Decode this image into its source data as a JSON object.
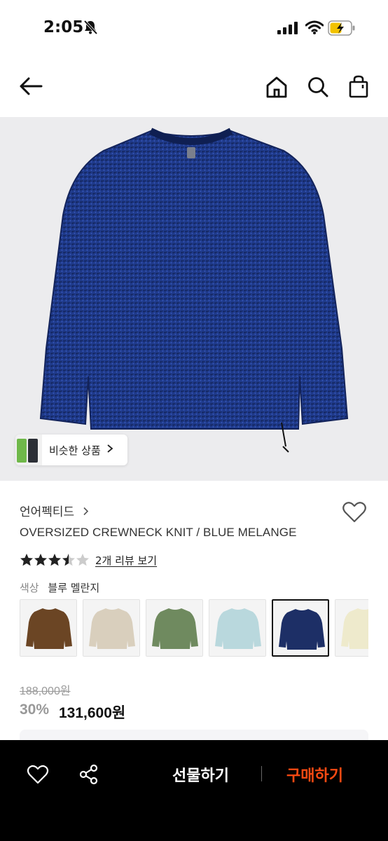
{
  "status_bar": {
    "time": "2:05"
  },
  "similar_products": {
    "label": "비슷한 상품"
  },
  "product": {
    "brand": "언어펙티드",
    "name": "OVERSIZED CREWNECK KNIT / BLUE MELANGE",
    "rating_stars": 3.5,
    "review_link": "2개 리뷰 보기",
    "color_label": "색상",
    "color_value": "블루 멜란지",
    "swatch_colors": [
      "#6b4524",
      "#d9cfbd",
      "#6f8a5f",
      "#b9d8dd",
      "#1d2f66",
      "#eeeacc"
    ],
    "selected_swatch_index": 4,
    "original_price": "188,000원",
    "discount": "30%",
    "final_price": "131,600원"
  },
  "bottom_bar": {
    "gift_label": "선물하기",
    "buy_label": "구매하기"
  },
  "colors": {
    "accent": "#ff4a12",
    "sweater": "#1f3a8a",
    "hero_bg": "#ececee"
  },
  "icons": [
    "bell-off-icon",
    "signal-icon",
    "wifi-icon",
    "battery-icon",
    "back-arrow-icon",
    "home-icon",
    "search-icon",
    "shopping-bag-icon",
    "heart-icon",
    "share-icon",
    "chevron-right-icon",
    "star-icon"
  ]
}
